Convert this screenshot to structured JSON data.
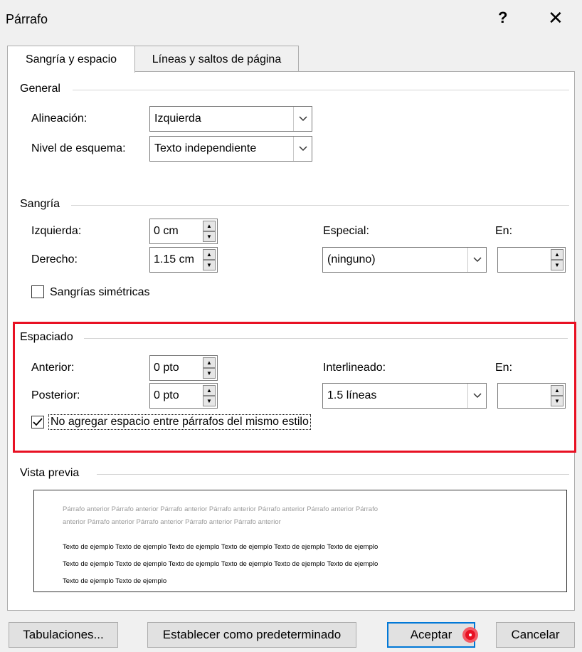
{
  "window": {
    "title": "Párrafo",
    "help": "?",
    "close": "✕"
  },
  "tabs": [
    {
      "label": "Sangría y espacio",
      "active": true
    },
    {
      "label": "Líneas y saltos de página",
      "active": false
    }
  ],
  "general": {
    "heading": "General",
    "alineacion_label": "Alineación:",
    "alineacion_value": "Izquierda",
    "nivel_label": "Nivel de esquema:",
    "nivel_value": "Texto independiente"
  },
  "sangria": {
    "heading": "Sangría",
    "izquierda_label": "Izquierda:",
    "izquierda_value": "0 cm",
    "derecho_label": "Derecho:",
    "derecho_value": "1.15 cm",
    "especial_label": "Especial:",
    "especial_value": "(ninguno)",
    "en_label": "En:",
    "en_value": "",
    "simetricas_label": "Sangrías simétricas",
    "simetricas_checked": false
  },
  "espaciado": {
    "heading": "Espaciado",
    "anterior_label": "Anterior:",
    "anterior_value": "0 pto",
    "posterior_label": "Posterior:",
    "posterior_value": "0 pto",
    "interlineado_label": "Interlineado:",
    "interlineado_value": "1.5 líneas",
    "en_label": "En:",
    "en_value": "",
    "no_agregar_label": "No agregar espacio entre párrafos del mismo estilo",
    "no_agregar_checked": true
  },
  "vista_previa": {
    "heading": "Vista previa",
    "prev_line1": "Párrafo anterior Párrafo anterior Párrafo anterior Párrafo anterior Párrafo anterior Párrafo anterior Párrafo",
    "prev_line2": "anterior Párrafo anterior Párrafo anterior Párrafo anterior Párrafo anterior",
    "sample_line1": "Texto de ejemplo Texto de ejemplo Texto de ejemplo Texto de ejemplo Texto de ejemplo Texto de ejemplo",
    "sample_line2": "Texto de ejemplo Texto de ejemplo Texto de ejemplo Texto de ejemplo Texto de ejemplo Texto de ejemplo",
    "sample_line3": "Texto de ejemplo Texto de ejemplo"
  },
  "buttons": {
    "tabulaciones": "Tabulaciones...",
    "predeterminado": "Establecer como predeterminado",
    "aceptar": "Aceptar",
    "cancelar": "Cancelar"
  },
  "colors": {
    "highlight": "#e81123",
    "accent": "#0078d7"
  }
}
